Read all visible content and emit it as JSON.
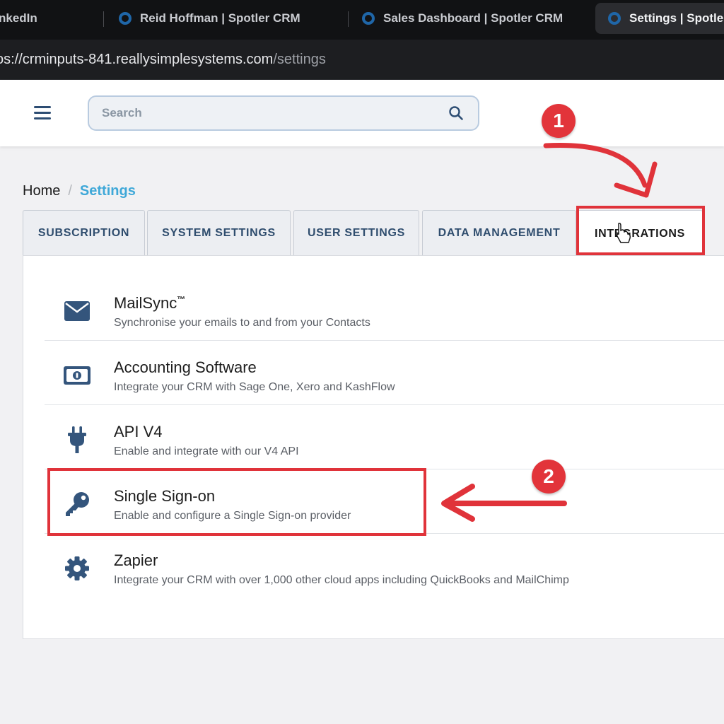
{
  "browser": {
    "tabs": [
      {
        "label": "nkedIn",
        "active": false
      },
      {
        "label": "Reid Hoffman | Spotler CRM",
        "active": false
      },
      {
        "label": "Sales Dashboard | Spotler CRM",
        "active": false
      },
      {
        "label": "Settings | Spotle",
        "active": true
      }
    ],
    "url_main": "os://crminputs-841.reallysimplesystems.com",
    "url_path": "/settings"
  },
  "header": {
    "search_placeholder": "Search"
  },
  "breadcrumb": {
    "home": "Home",
    "separator": "/",
    "current": "Settings"
  },
  "tabs": [
    {
      "label": "SUBSCRIPTION",
      "active": false
    },
    {
      "label": "SYSTEM SETTINGS",
      "active": false
    },
    {
      "label": "USER SETTINGS",
      "active": false
    },
    {
      "label": "DATA MANAGEMENT",
      "active": false
    },
    {
      "label": "INTEGRATIONS",
      "active": true
    }
  ],
  "integrations": [
    {
      "title": "MailSync",
      "superscript": "™",
      "description": "Synchronise your emails to and from your Contacts",
      "icon": "envelope-icon"
    },
    {
      "title": "Accounting Software",
      "superscript": "",
      "description": "Integrate your CRM with Sage One, Xero and KashFlow",
      "icon": "money-bill-icon"
    },
    {
      "title": "API V4",
      "superscript": "",
      "description": "Enable and integrate with our V4 API",
      "icon": "plug-icon"
    },
    {
      "title": "Single Sign-on",
      "superscript": "",
      "description": "Enable and configure a Single Sign-on provider",
      "icon": "key-icon"
    },
    {
      "title": "Zapier",
      "superscript": "",
      "description": "Integrate your CRM with over 1,000 other cloud apps including QuickBooks and MailChimp",
      "icon": "gear-icon"
    }
  ],
  "annotations": {
    "step1": "1",
    "step2": "2",
    "color": "#e0333a"
  },
  "colors": {
    "accent": "#3fa8d8",
    "navy": "#2f4d6e",
    "icon": "#34557c"
  }
}
